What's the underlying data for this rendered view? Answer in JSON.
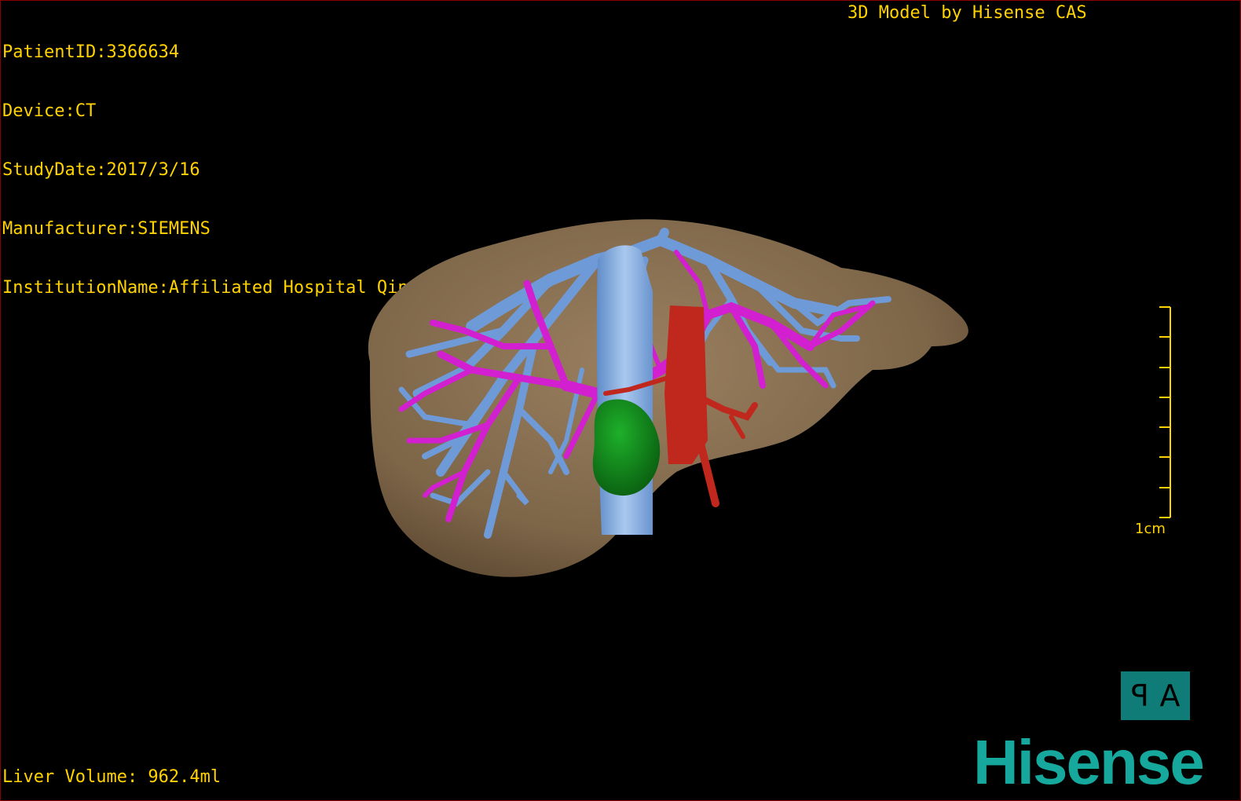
{
  "overlay": {
    "patient_id": "PatientID:3366634",
    "device": "Device:CT",
    "study_date": "StudyDate:2017/3/16",
    "manufacturer": "Manufacturer:SIEMENS",
    "institution": "InstitutionName:Affiliated Hospital Qingdao University-C",
    "model_credit": "3D Model by Hisense CAS",
    "liver_volume": "Liver Volume: 962.4ml"
  },
  "scale_bar": {
    "label": "1cm"
  },
  "orientation": {
    "left_glyph": "P",
    "right_glyph": "A"
  },
  "brand": {
    "logo_text": "Hisense"
  },
  "colors": {
    "overlay_text": "#ffd200",
    "liver": "#8a7253",
    "hepatic_vein": "#6f9ad8",
    "portal_vein": "#d21fd0",
    "artery": "#c0271d",
    "tumor": "#0f8a1a",
    "logo": "#16a79d",
    "orientation_box": "#0f7c78"
  }
}
